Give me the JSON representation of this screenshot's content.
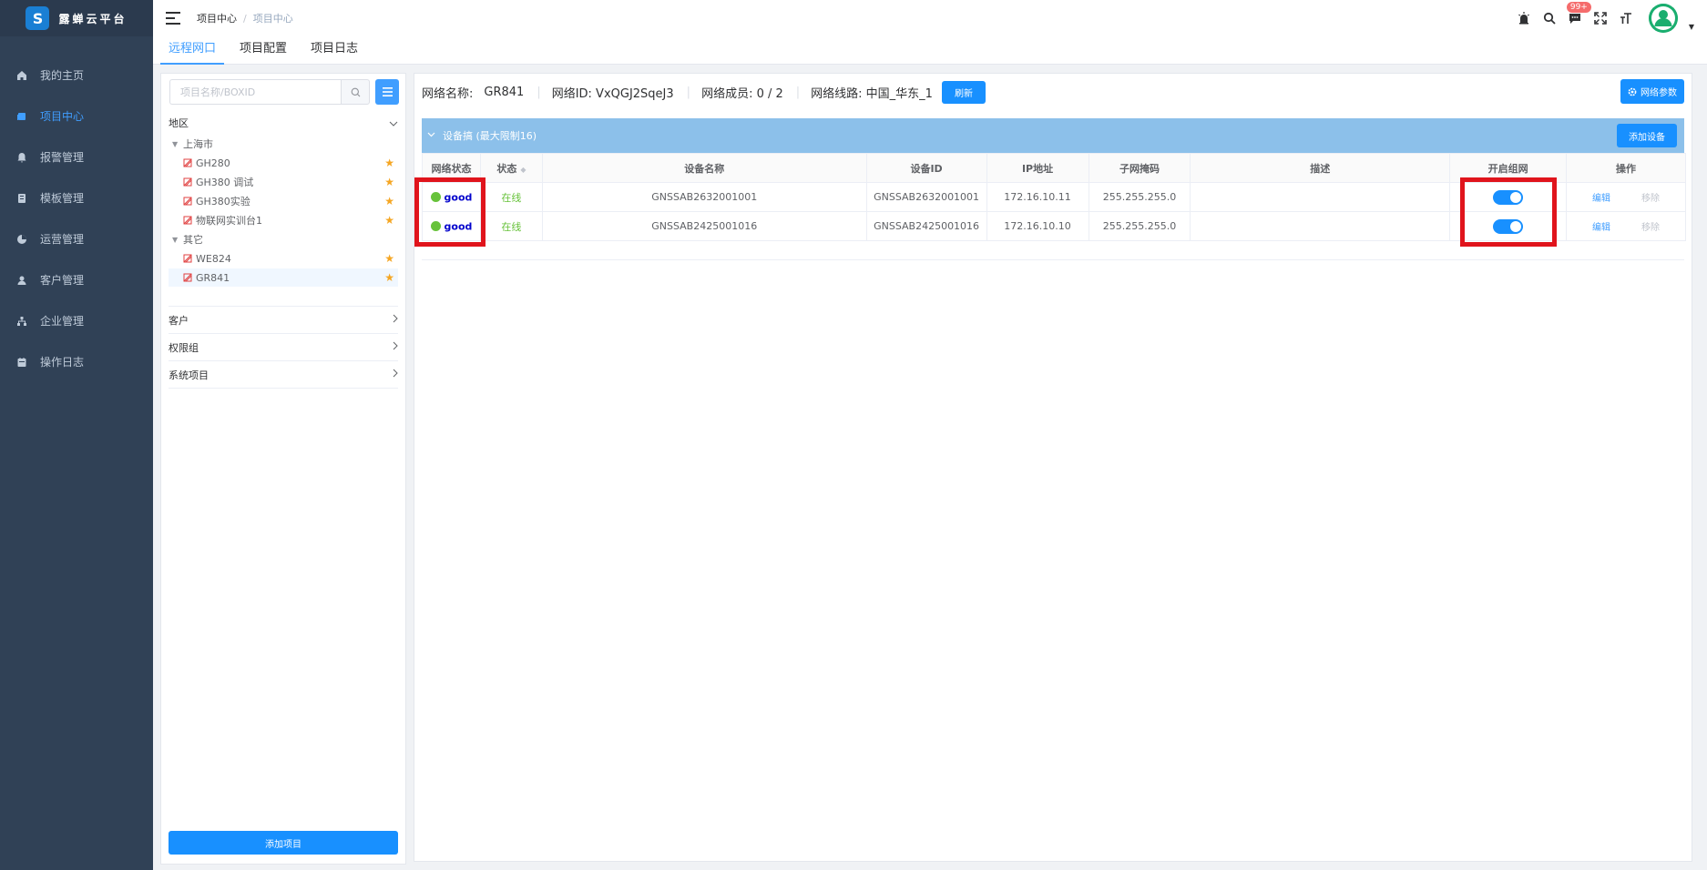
{
  "app": {
    "title": "露蝉云平台",
    "logo_letter": "S"
  },
  "sidebar": {
    "items": [
      {
        "label": "我的主页",
        "icon": "home-icon"
      },
      {
        "label": "项目中心",
        "icon": "project-icon",
        "active": true
      },
      {
        "label": "报警管理",
        "icon": "bell-icon"
      },
      {
        "label": "模板管理",
        "icon": "template-icon"
      },
      {
        "label": "运营管理",
        "icon": "chart-pie-icon"
      },
      {
        "label": "客户管理",
        "icon": "user-icon"
      },
      {
        "label": "企业管理",
        "icon": "org-icon"
      },
      {
        "label": "操作日志",
        "icon": "log-icon"
      }
    ]
  },
  "header": {
    "breadcrumb": [
      "项目中心",
      "项目中心"
    ],
    "sep": "/",
    "notify_badge": "99+"
  },
  "tabs": [
    {
      "label": "远程网口",
      "active": true
    },
    {
      "label": "项目配置"
    },
    {
      "label": "项目日志"
    }
  ],
  "left": {
    "search_placeholder": "项目名称/BOXID",
    "region_label": "地区",
    "tree": [
      {
        "label": "上海市",
        "level": 0
      },
      {
        "label": "GH280",
        "level": 1
      },
      {
        "label": "GH380 调试",
        "level": 1
      },
      {
        "label": "GH380实验",
        "level": 1
      },
      {
        "label": "物联网实训台1",
        "level": 1
      },
      {
        "label": "其它",
        "level": 0
      },
      {
        "label": "WE824",
        "level": 1
      },
      {
        "label": "GR841",
        "level": 1,
        "selected": true
      }
    ],
    "categories": [
      "客户",
      "权限组",
      "系统项目"
    ],
    "add_button": "添加项目"
  },
  "main": {
    "network_name_label": "网络名称:",
    "network_name": "GR841",
    "network_id": "网络ID: VxQGJ2SqeJ3",
    "members": "网络成员: 0 / 2",
    "route": "网络线路: 中国_华东_1",
    "refresh": "刷新",
    "params_button": "网络参数",
    "group_title": "设备搞 (最大限制16)",
    "add_device": "添加设备",
    "columns": [
      "网络状态",
      "状态",
      "设备名称",
      "设备ID",
      "IP地址",
      "子网掩码",
      "描述",
      "开启组网",
      "操作"
    ],
    "rows": [
      {
        "net_status": "good",
        "status": "在线",
        "name": "GNSSAB2632001001",
        "id": "GNSSAB2632001001",
        "ip": "172.16.10.11",
        "mask": "255.255.255.0",
        "desc": "",
        "enabled": true,
        "edit": "编辑",
        "remove": "移除"
      },
      {
        "net_status": "good",
        "status": "在线",
        "name": "GNSSAB2425001016",
        "id": "GNSSAB2425001016",
        "ip": "172.16.10.10",
        "mask": "255.255.255.0",
        "desc": "",
        "enabled": true,
        "edit": "编辑",
        "remove": "移除"
      }
    ]
  },
  "colors": {
    "sidebar": "#304156",
    "accent": "#1890ff",
    "highlight": "#e0141c",
    "group_bar": "#8cc0ea"
  }
}
